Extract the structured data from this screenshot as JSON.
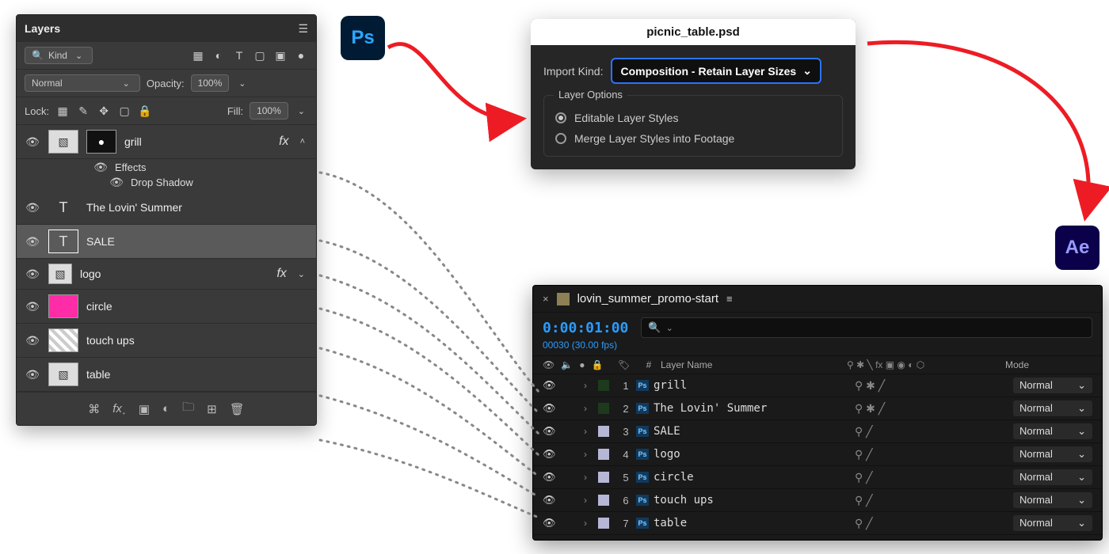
{
  "pspanel": {
    "tab": "Layers",
    "kind_label": "Kind",
    "blend_mode": "Normal",
    "opacity_label": "Opacity:",
    "opacity_value": "100%",
    "lock_label": "Lock:",
    "fill_label": "Fill:",
    "fill_value": "100%",
    "effects_label": "Effects",
    "dropshadow_label": "Drop Shadow",
    "layers": [
      {
        "name": "grill",
        "has_mask": true,
        "fx": true,
        "type": "smart"
      },
      {
        "name": "The  Lovin' Summer",
        "type": "text"
      },
      {
        "name": "SALE",
        "type": "text",
        "selected": true
      },
      {
        "name": "logo",
        "type": "smart",
        "fx": true
      },
      {
        "name": "circle",
        "type": "shape"
      },
      {
        "name": "touch ups",
        "type": "pixel"
      },
      {
        "name": "table",
        "type": "pixel"
      }
    ]
  },
  "ps_badge": "Ps",
  "ae_badge": "Ae",
  "import": {
    "filename": "picnic_table.psd",
    "kind_label": "Import Kind:",
    "kind_value": "Composition - Retain Layer Sizes",
    "options_title": "Layer Options",
    "option_editable": "Editable Layer Styles",
    "option_merge": "Merge Layer Styles into Footage"
  },
  "aepanel": {
    "comp_name": "lovin_summer_promo-start",
    "timecode": "0:00:01:00",
    "frames": "00030 (30.00 fps)",
    "col_num": "#",
    "col_layer": "Layer Name",
    "col_mode": "Mode",
    "mode_normal": "Normal",
    "layers": [
      {
        "n": 1,
        "name": "grill",
        "color": "gr",
        "sun": true
      },
      {
        "n": 2,
        "name": "The Lovin' Summer",
        "color": "gr",
        "sun": true
      },
      {
        "n": 3,
        "name": "SALE"
      },
      {
        "n": 4,
        "name": "logo"
      },
      {
        "n": 5,
        "name": "circle"
      },
      {
        "n": 6,
        "name": "touch ups"
      },
      {
        "n": 7,
        "name": "table"
      }
    ]
  }
}
